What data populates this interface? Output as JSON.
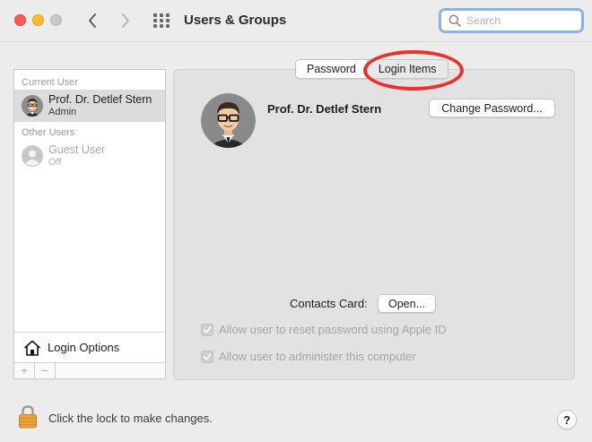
{
  "window": {
    "title": "Users & Groups"
  },
  "search": {
    "placeholder": "Search",
    "value": ""
  },
  "sidebar": {
    "current_user_header": "Current User",
    "other_users_header": "Other Users",
    "users": [
      {
        "name": "Prof. Dr. Detlef Stern",
        "role": "Admin",
        "selected": true
      },
      {
        "name": "Guest User",
        "role": "Off",
        "selected": false
      }
    ],
    "login_options_label": "Login Options",
    "add_label": "+",
    "remove_label": "−"
  },
  "tabs": {
    "password_label": "Password",
    "login_items_label": "Login Items",
    "active": "Login Items"
  },
  "profile": {
    "name": "Prof. Dr. Detlef Stern",
    "change_password_label": "Change Password..."
  },
  "contacts": {
    "label": "Contacts Card:",
    "open_label": "Open..."
  },
  "options": {
    "allow_reset_label": "Allow user to reset password using Apple ID",
    "allow_reset_checked": true,
    "allow_admin_label": "Allow user to administer this computer",
    "allow_admin_checked": true
  },
  "footer": {
    "lock_text": "Click the lock to make changes.",
    "help_label": "?"
  },
  "colors": {
    "annotation": "#e8332a",
    "search_focus": "#8ab4e8"
  },
  "icons": [
    "close-icon",
    "minimize-icon",
    "zoom-icon",
    "chevron-left-icon",
    "chevron-right-icon",
    "grid-icon",
    "search-icon",
    "avatar-icon",
    "house-icon",
    "checkmark-icon",
    "lock-icon"
  ]
}
